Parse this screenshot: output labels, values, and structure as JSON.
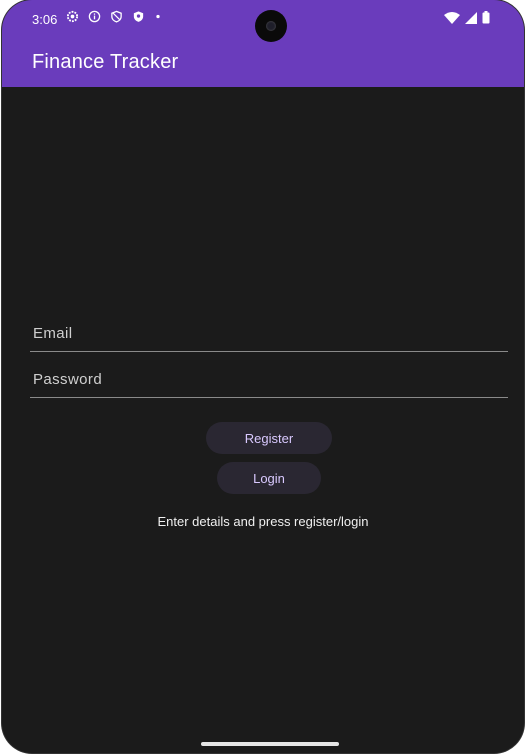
{
  "status_bar": {
    "time": "3:06",
    "left_icons": [
      "settings-icon",
      "info-icon",
      "vpn-icon",
      "shield-icon",
      "dot-icon"
    ],
    "right_icons": [
      "wifi-icon",
      "signal-icon",
      "battery-icon"
    ]
  },
  "app_bar": {
    "title": "Finance Tracker",
    "color": "#6a3cbc"
  },
  "form": {
    "email_placeholder": "Email",
    "email_value": "",
    "password_placeholder": "Password",
    "password_value": ""
  },
  "buttons": {
    "register_label": "Register",
    "login_label": "Login"
  },
  "status_message": "Enter details and press register/login",
  "colors": {
    "background": "#1b1b1b",
    "button_bg": "#2a2732",
    "button_text": "#d9c9ff"
  }
}
